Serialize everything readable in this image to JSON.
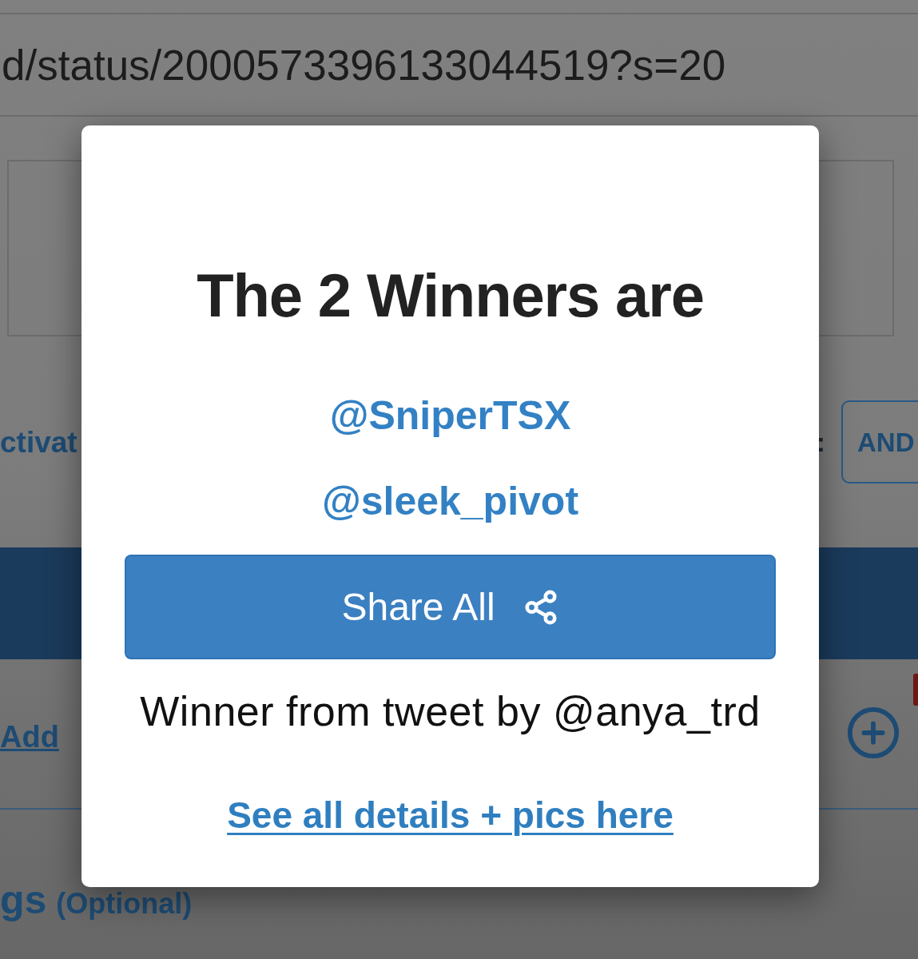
{
  "page": {
    "url_text": "d/status/2000573396133044519?s=20",
    "activation_label": "ctivat",
    "label_suffix": ":",
    "operator_button": "AND",
    "add_link": "Add",
    "section_heading": "gs",
    "section_note": "(Optional)"
  },
  "modal": {
    "title": "The 2 Winners are",
    "winners": [
      "@SniperTSX",
      "@sleek_pivot"
    ],
    "share_button": "Share All",
    "source_text": "Winner from tweet by @anya_trd",
    "details_link": "See all details + pics here"
  }
}
